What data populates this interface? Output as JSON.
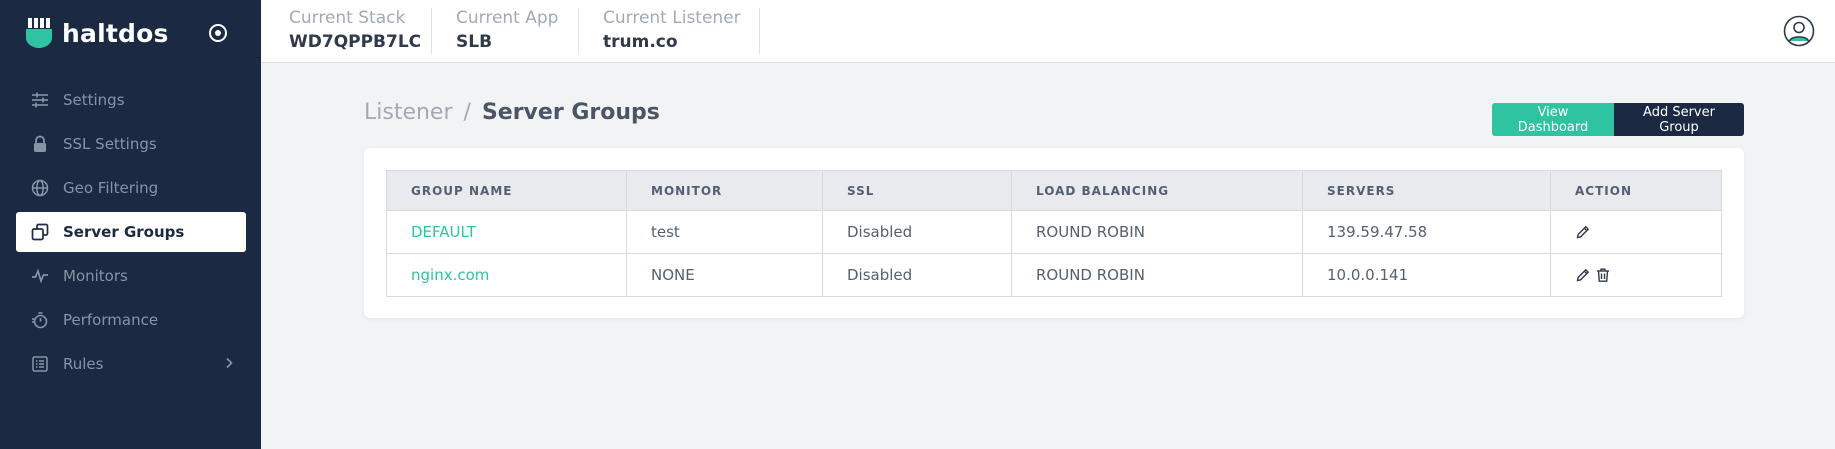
{
  "brand": {
    "name": "haltdos"
  },
  "sidebar": {
    "items": [
      {
        "label": "Settings",
        "icon": "sliders-icon",
        "active": false
      },
      {
        "label": "SSL Settings",
        "icon": "lock-icon",
        "active": false
      },
      {
        "label": "Geo Filtering",
        "icon": "globe-icon",
        "active": false
      },
      {
        "label": "Server Groups",
        "icon": "server-groups-icon",
        "active": true
      },
      {
        "label": "Monitors",
        "icon": "pulse-icon",
        "active": false
      },
      {
        "label": "Performance",
        "icon": "stopwatch-icon",
        "active": false
      },
      {
        "label": "Rules",
        "icon": "list-icon",
        "active": false,
        "has_submenu": true
      }
    ]
  },
  "topbar": {
    "stack": {
      "label": "Current Stack",
      "value": "WD7QPPB7LC"
    },
    "app": {
      "label": "Current App",
      "value": "SLB"
    },
    "listener": {
      "label": "Current Listener",
      "value": "trum.co"
    }
  },
  "breadcrumb": {
    "parent": "Listener",
    "separator": "/",
    "current": "Server Groups"
  },
  "buttons": {
    "view_dashboard": "View Dashboard",
    "add_server_group": "Add Server Group"
  },
  "table": {
    "headers": [
      "GROUP NAME",
      "MONITOR",
      "SSL",
      "LOAD BALANCING",
      "SERVERS",
      "ACTION"
    ],
    "rows": [
      {
        "group_name": "DEFAULT",
        "monitor": "test",
        "ssl": "Disabled",
        "load_balancing": "ROUND ROBIN",
        "servers": "139.59.47.58",
        "actions": [
          "edit"
        ]
      },
      {
        "group_name": "nginx.com",
        "monitor": "NONE",
        "ssl": "Disabled",
        "load_balancing": "ROUND ROBIN",
        "servers": "10.0.0.141",
        "actions": [
          "edit",
          "delete"
        ]
      }
    ]
  },
  "colors": {
    "sidebar_bg": "#1b2a42",
    "accent": "#2ec4a1",
    "page_bg": "#f2f3f5"
  }
}
